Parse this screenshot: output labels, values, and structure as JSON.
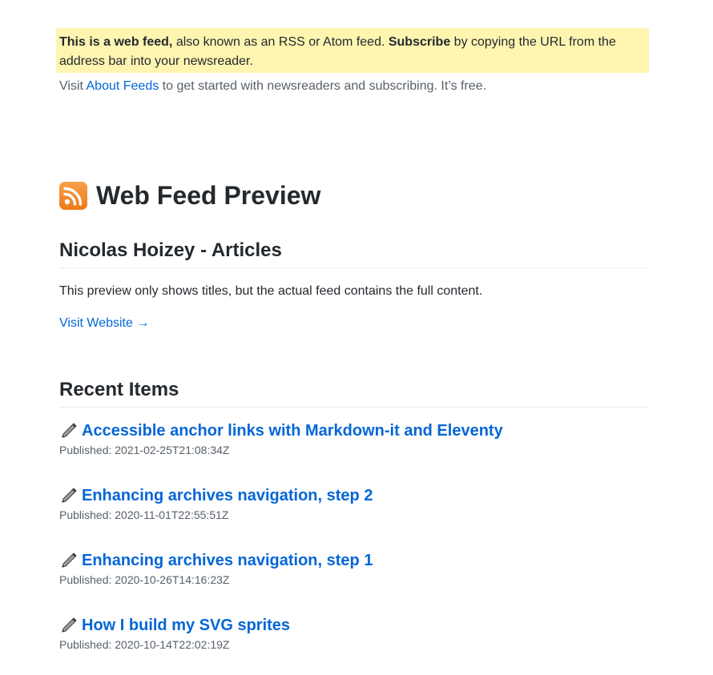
{
  "notice": {
    "bold_lead": "This is a web feed,",
    "text_1": " also known as an RSS or Atom feed. ",
    "bold_subscribe": "Subscribe",
    "text_2": " by copying the URL from the address bar into your newsreader."
  },
  "intro": {
    "prefix": "Visit ",
    "link": "About Feeds",
    "suffix": " to get started with newsreaders and subscribing. It’s free."
  },
  "preview": {
    "icon": "rss-icon",
    "title": "Web Feed Preview"
  },
  "feed": {
    "title": "Nicolas Hoizey - Articles",
    "description": "This preview only shows titles, but the actual feed contains the full content.",
    "visit_label": "Visit Website →"
  },
  "recent": {
    "heading": "Recent Items",
    "items": [
      {
        "icon": "pen-icon",
        "title": "Accessible anchor links with Markdown-it and Eleventy",
        "published": "Published: 2021-02-25T21:08:34Z"
      },
      {
        "icon": "pen-icon",
        "title": "Enhancing archives navigation, step 2",
        "published": "Published: 2020-11-01T22:55:51Z"
      },
      {
        "icon": "pen-icon",
        "title": "Enhancing archives navigation, step 1",
        "published": "Published: 2020-10-26T14:16:23Z"
      },
      {
        "icon": "pen-icon",
        "title": "How I build my SVG sprites",
        "published": "Published: 2020-10-14T22:02:19Z"
      }
    ]
  },
  "colors": {
    "notice_bg": "#fff5b1",
    "link": "#0366d6",
    "rss_orange": "#ef7a17"
  }
}
